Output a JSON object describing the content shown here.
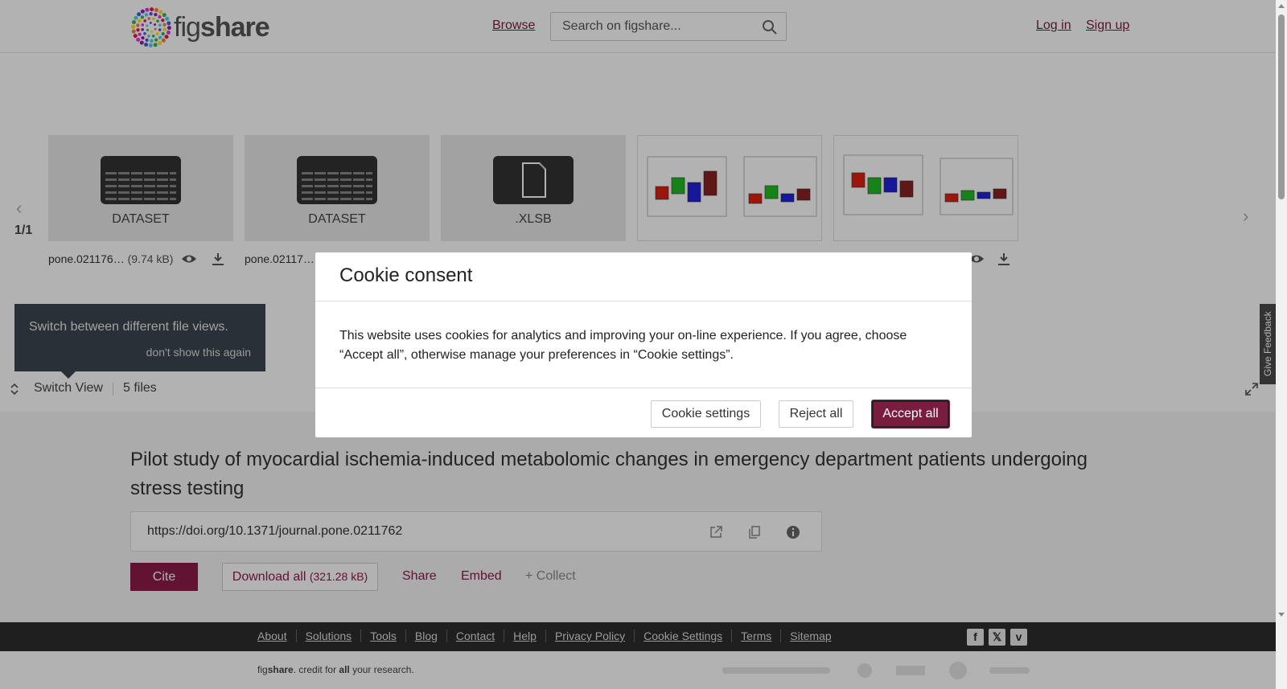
{
  "header": {
    "logo": {
      "prefix": "fig",
      "suffix": "share"
    },
    "browse_label": "Browse",
    "search_placeholder": "Search on figshare...",
    "login_label": "Log in",
    "signup_label": "Sign up"
  },
  "viewer": {
    "page_counter": "1/1",
    "files": [
      {
        "label": "DATASET",
        "name": "pone.021176…",
        "size": "(9.74 kB)"
      },
      {
        "label": "DATASET",
        "name": "pone.02117…",
        "size": ""
      },
      {
        "label": ".XLSB",
        "name": "",
        "size": ""
      },
      {
        "label": "",
        "name": "",
        "size": ""
      },
      {
        "label": "",
        "name": "",
        "size": ""
      }
    ],
    "tooltip_text": "Switch between different file views.",
    "tooltip_dismiss": "don't show this again",
    "switch_view_label": "Switch View",
    "files_count": "5 files"
  },
  "article": {
    "title": "Pilot study of myocardial ischemia-induced metabolomic changes in emergency department patients undergoing stress testing",
    "doi": "https://doi.org/10.1371/journal.pone.0211762",
    "cite_label": "Cite",
    "download_label": "Download all",
    "download_size": "(321.28 kB)",
    "share_label": "Share",
    "embed_label": "Embed",
    "collect_label": "+ Collect"
  },
  "footer": {
    "links": [
      "About",
      "Solutions",
      "Tools",
      "Blog",
      "Contact",
      "Help",
      "Privacy Policy",
      "Cookie Settings",
      "Terms",
      "Sitemap"
    ],
    "tagline_fig": "fig",
    "tagline_share": "share",
    "tagline_mid": ". credit for ",
    "tagline_all": "all",
    "tagline_end": " your research."
  },
  "feedback_label": "Give Feedback",
  "cookie": {
    "title": "Cookie consent",
    "body": "This website uses cookies for analytics and improving your on-line experience. If you agree, choose “Accept all”, otherwise manage your preferences in “Cookie settings”.",
    "settings_label": "Cookie settings",
    "reject_label": "Reject all",
    "accept_label": "Accept all"
  },
  "colors": {
    "brand": "#7a1c3e",
    "cite": "#8d1b4a"
  }
}
